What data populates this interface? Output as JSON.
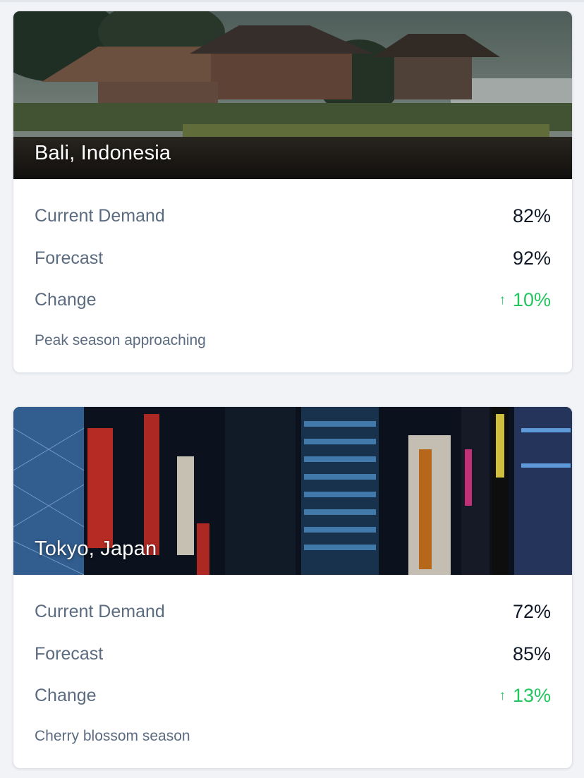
{
  "destinations": [
    {
      "name": "Bali, Indonesia",
      "image": "bali-temple-lake-photo",
      "metrics": [
        {
          "label": "Current Demand",
          "value": "82%"
        },
        {
          "label": "Forecast",
          "value": "92%"
        }
      ],
      "change": {
        "label": "Change",
        "value": "10%",
        "icon": "arrow-up-icon",
        "color": "#22c55e"
      },
      "note": "Peak season approaching"
    },
    {
      "name": "Tokyo, Japan",
      "image": "tokyo-neon-street-photo",
      "metrics": [
        {
          "label": "Current Demand",
          "value": "72%"
        },
        {
          "label": "Forecast",
          "value": "85%"
        }
      ],
      "change": {
        "label": "Change",
        "value": "13%",
        "icon": "arrow-up-icon",
        "color": "#22c55e"
      },
      "note": "Cherry blossom season"
    }
  ],
  "icons": {
    "up_arrow": "↑"
  },
  "colors": {
    "positive": "#22c55e",
    "label": "#5b6b80",
    "value": "#101828"
  }
}
